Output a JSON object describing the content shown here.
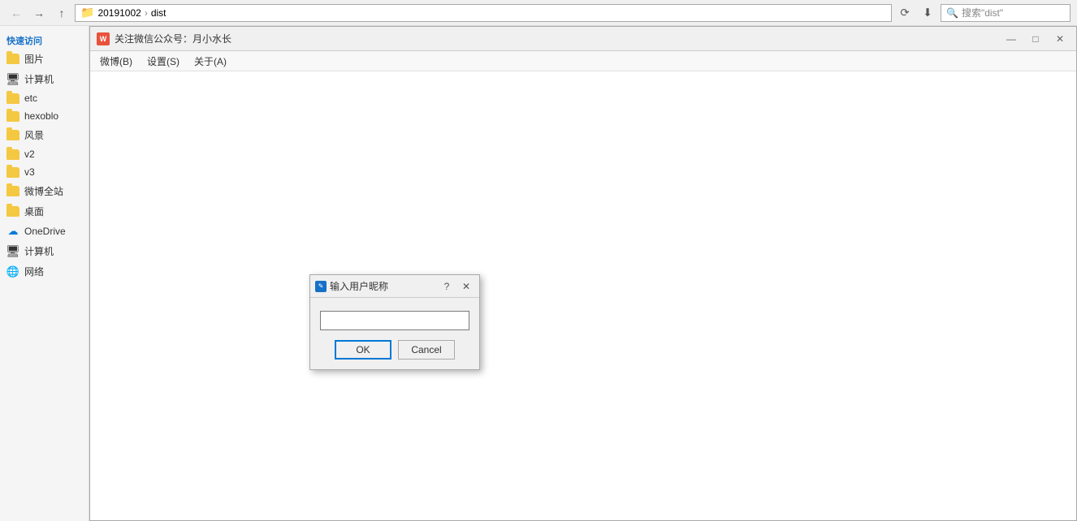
{
  "topbar": {
    "back_label": "←",
    "forward_label": "→",
    "up_label": "↑",
    "breadcrumb": {
      "parts": [
        "20191002",
        "dist"
      ]
    },
    "search_placeholder": "搜索\"dist\"",
    "refresh_label": "⟳"
  },
  "sidebar": {
    "quick_access_label": "快速访问",
    "items": [
      {
        "label": "图片",
        "type": "folder"
      },
      {
        "label": "计算机",
        "type": "computer"
      },
      {
        "label": "etc",
        "type": "folder"
      },
      {
        "label": "hexoblo",
        "type": "folder"
      },
      {
        "label": "风景",
        "type": "folder"
      },
      {
        "label": "v2",
        "type": "folder"
      },
      {
        "label": "v3",
        "type": "folder"
      },
      {
        "label": "微博全站",
        "type": "folder"
      },
      {
        "label": "桌面",
        "type": "folder"
      },
      {
        "label": "OneDrive",
        "type": "onedrive"
      },
      {
        "label": "计算机",
        "type": "computer"
      },
      {
        "label": "网络",
        "type": "network"
      }
    ]
  },
  "weibo_window": {
    "title": "关注微信公众号：月小水长",
    "icon_text": "W",
    "menubar": {
      "items": [
        "微博(B)",
        "设置(S)",
        "关于(A)"
      ]
    },
    "minimize_label": "—",
    "maximize_label": "□",
    "close_label": "✕"
  },
  "input_dialog": {
    "title": "输入用户昵称",
    "icon_text": "✎",
    "help_label": "?",
    "close_label": "✕",
    "input_value": "",
    "ok_label": "OK",
    "cancel_label": "Cancel"
  }
}
